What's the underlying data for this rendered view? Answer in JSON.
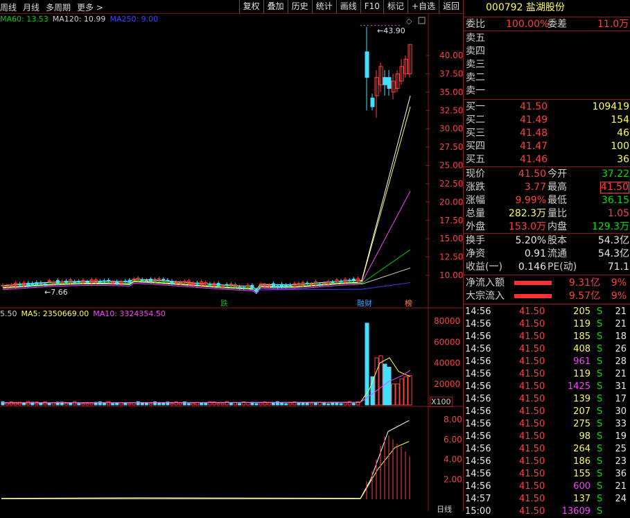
{
  "toolbar": {
    "left_items": [
      "周线",
      "月线",
      "多周期",
      "更多 >"
    ],
    "right_items": [
      "复权",
      "叠加",
      "历史",
      "统计",
      "画线",
      "F10",
      "标记",
      "+自选",
      "返回"
    ]
  },
  "main_chart": {
    "ma_legend": [
      {
        "label": "MA60: 13.53",
        "color": "#00d000"
      },
      {
        "label": "MA120: 10.99",
        "color": "#d0d0d0"
      },
      {
        "label": "MA250: 9.00",
        "color": "#4040ff"
      }
    ],
    "price_axis": [
      "40.00",
      "37.50",
      "35.00",
      "32.50",
      "30.00",
      "27.50",
      "25.00",
      "22.50",
      "20.00",
      "17.50",
      "15.00",
      "12.50",
      "10.00"
    ],
    "high_marker": "43.90",
    "low_marker": "7.66",
    "event_tags": [
      {
        "label": "跌",
        "color": "#00c000"
      },
      {
        "label": "融财",
        "color": "#40a0ff"
      },
      {
        "label": "榜",
        "color": "#ff8040"
      }
    ]
  },
  "volume_chart": {
    "legend": [
      {
        "label": "5.50",
        "color": "#d0d0d0"
      },
      {
        "label": "MA5: 2350669.00",
        "color": "#ffff50"
      },
      {
        "label": "MA10: 3324354.50",
        "color": "#ff40ff"
      }
    ],
    "axis": [
      "80000",
      "60000",
      "40000",
      "20000"
    ],
    "unit": "X100"
  },
  "indicator_chart": {
    "axis": [
      "8.00",
      "6.00",
      "4.00",
      "2.00"
    ],
    "bottom_label": "日线"
  },
  "stock": {
    "code": "000792",
    "name": "盐湖股份",
    "weibi_label": "委比",
    "weibi_value": "100.00%",
    "weicha_label": "委差",
    "weicha_value": "11.0万"
  },
  "order_book": {
    "sell": [
      {
        "label": "卖五",
        "price": "",
        "vol": ""
      },
      {
        "label": "卖四",
        "price": "",
        "vol": ""
      },
      {
        "label": "卖三",
        "price": "",
        "vol": ""
      },
      {
        "label": "卖二",
        "price": "",
        "vol": ""
      },
      {
        "label": "卖一",
        "price": "",
        "vol": ""
      }
    ],
    "buy": [
      {
        "label": "买一",
        "price": "41.50",
        "vol": "109419"
      },
      {
        "label": "买二",
        "price": "41.49",
        "vol": "154"
      },
      {
        "label": "买三",
        "price": "41.48",
        "vol": "46"
      },
      {
        "label": "买四",
        "price": "41.47",
        "vol": "100"
      },
      {
        "label": "买五",
        "price": "41.46",
        "vol": "36"
      }
    ]
  },
  "quote": [
    {
      "l1": "现价",
      "v1": "41.50",
      "c1": "red",
      "l2": "今开",
      "v2": "37.22",
      "c2": "green"
    },
    {
      "l1": "涨跌",
      "v1": "3.77",
      "c1": "red",
      "l2": "最高",
      "v2": "41.50",
      "c2": "red"
    },
    {
      "l1": "涨幅",
      "v1": "9.99%",
      "c1": "red",
      "l2": "最低",
      "v2": "36.15",
      "c2": "green"
    },
    {
      "l1": "总量",
      "v1": "282.3万",
      "c1": "yellow",
      "l2": "量比",
      "v2": "1.05",
      "c2": "red"
    },
    {
      "l1": "外盘",
      "v1": "153.0万",
      "c1": "red",
      "l2": "内盘",
      "v2": "129.3万",
      "c2": "green"
    }
  ],
  "fundamentals": [
    {
      "l1": "换手",
      "v1": "5.20%",
      "l2": "股本",
      "v2": "54.3亿"
    },
    {
      "l1": "净资",
      "v1": "0.91",
      "l2": "流通",
      "v2": "54.3亿"
    },
    {
      "l1": "收益(一)",
      "v1": "0.146",
      "l2": "PE(动)",
      "v2": "71.1"
    }
  ],
  "flows": [
    {
      "label": "净流入额",
      "value": "9.31亿",
      "pct": "9%"
    },
    {
      "label": "大宗流入",
      "value": "9.57亿",
      "pct": "9%"
    }
  ],
  "ticks": [
    {
      "time": "14:56",
      "price": "41.50",
      "vol": "205",
      "side": "S",
      "num": "21",
      "volColor": "#ffff50"
    },
    {
      "time": "14:56",
      "price": "41.50",
      "vol": "119",
      "side": "S",
      "num": "21",
      "volColor": "#ffff50"
    },
    {
      "time": "14:56",
      "price": "41.50",
      "vol": "185",
      "side": "S",
      "num": "18",
      "volColor": "#ffff50"
    },
    {
      "time": "14:56",
      "price": "41.50",
      "vol": "408",
      "side": "S",
      "num": "26",
      "volColor": "#ffff50"
    },
    {
      "time": "14:56",
      "price": "41.50",
      "vol": "961",
      "side": "S",
      "num": "28",
      "volColor": "#ff40ff"
    },
    {
      "time": "14:56",
      "price": "41.50",
      "vol": "119",
      "side": "S",
      "num": "21",
      "volColor": "#ffff50"
    },
    {
      "time": "14:56",
      "price": "41.50",
      "vol": "1425",
      "side": "S",
      "num": "31",
      "volColor": "#ff40ff"
    },
    {
      "time": "14:56",
      "price": "41.50",
      "vol": "139",
      "side": "S",
      "num": "17",
      "volColor": "#ffff50"
    },
    {
      "time": "14:56",
      "price": "41.50",
      "vol": "207",
      "side": "S",
      "num": "30",
      "volColor": "#ffff50"
    },
    {
      "time": "14:56",
      "price": "41.50",
      "vol": "275",
      "side": "S",
      "num": "33",
      "volColor": "#ffff50"
    },
    {
      "time": "14:56",
      "price": "41.50",
      "vol": "98",
      "side": "S",
      "num": "19",
      "volColor": "#ffff50"
    },
    {
      "time": "14:56",
      "price": "41.50",
      "vol": "264",
      "side": "S",
      "num": "25",
      "volColor": "#ffff50"
    },
    {
      "time": "14:56",
      "price": "41.50",
      "vol": "186",
      "side": "S",
      "num": "23",
      "volColor": "#ffff50"
    },
    {
      "time": "14:56",
      "price": "41.50",
      "vol": "155",
      "side": "S",
      "num": "36",
      "volColor": "#ffff50"
    },
    {
      "time": "14:56",
      "price": "41.50",
      "vol": "600",
      "side": "S",
      "num": "21",
      "volColor": "#ff40ff"
    },
    {
      "time": "14:57",
      "price": "41.50",
      "vol": "137",
      "side": "S",
      "num": "24",
      "volColor": "#ffff50"
    },
    {
      "time": "15:00",
      "price": "41.50",
      "vol": "13609",
      "side": "S",
      "num": "",
      "volColor": "#ff40ff"
    }
  ]
}
